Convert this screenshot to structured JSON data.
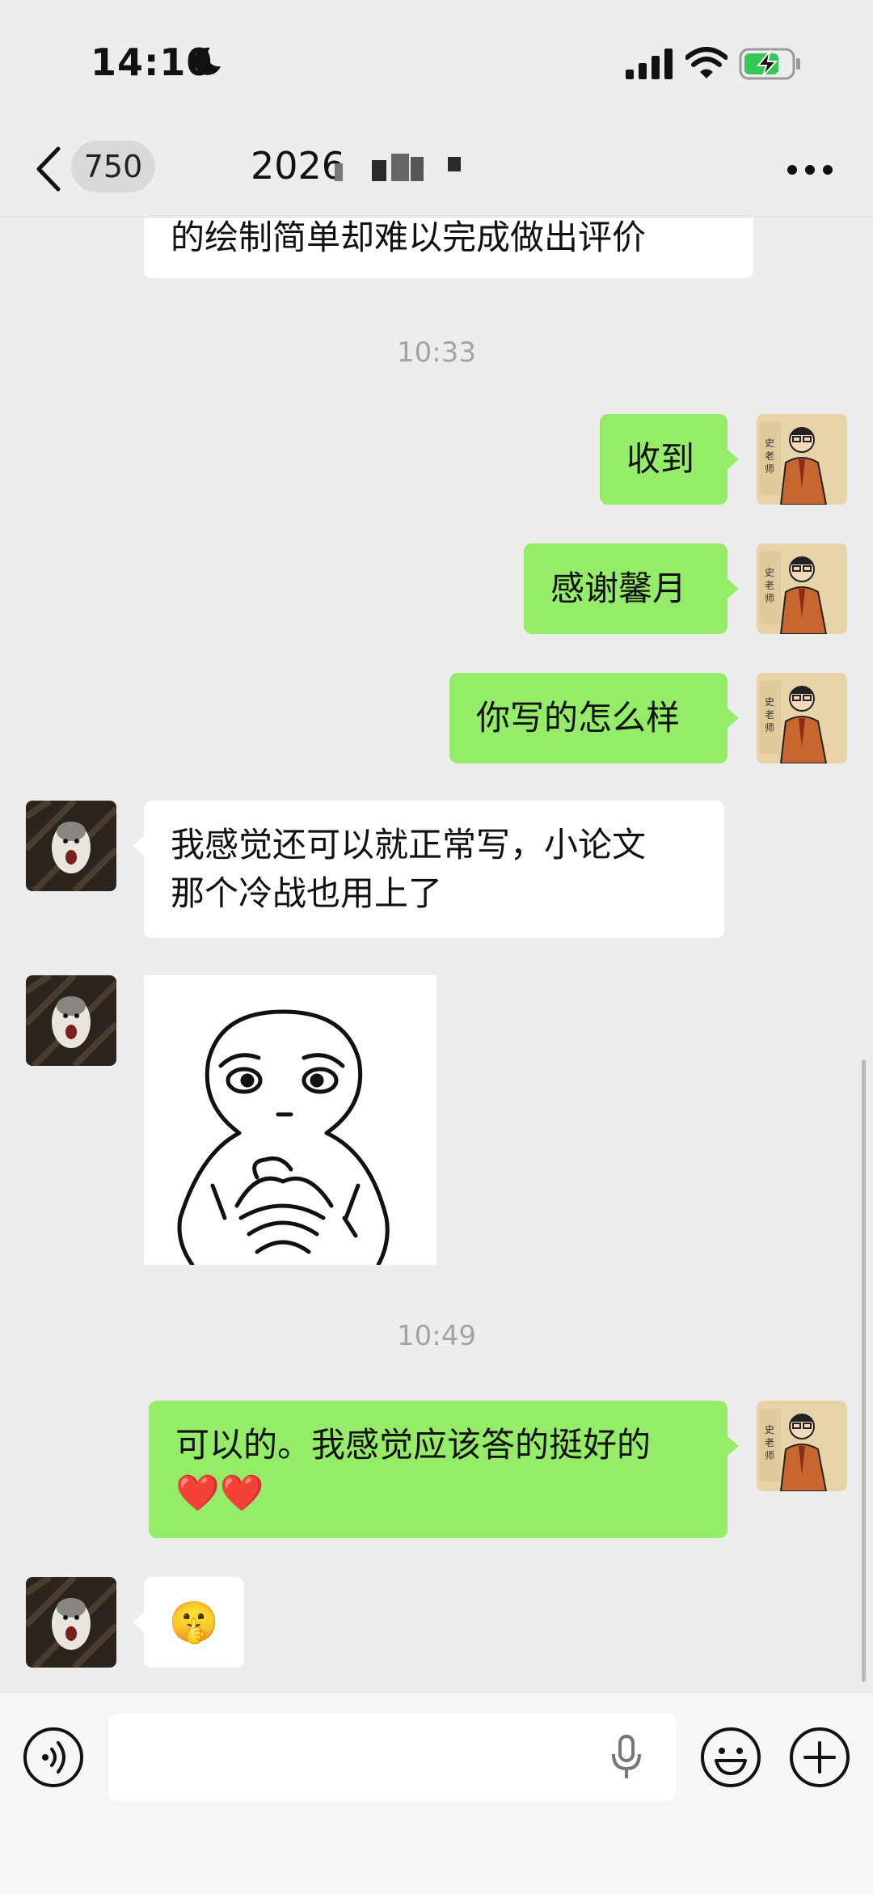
{
  "status_bar": {
    "time": "14:10"
  },
  "header": {
    "back_badge": "750",
    "title": "2026"
  },
  "messages": [
    {
      "side": "in",
      "text": "的绘制简单却难以完成做出评价"
    },
    {
      "timestamp": "10:33"
    },
    {
      "side": "out",
      "text": "收到"
    },
    {
      "side": "out",
      "text": "感谢馨月"
    },
    {
      "side": "out",
      "text": "你写的怎么样"
    },
    {
      "side": "in",
      "text_lines": [
        "我感觉还可以就正常写，小论文",
        "那个冷战也用上了"
      ]
    },
    {
      "side": "in",
      "type": "sticker",
      "sticker": "thinking-character"
    },
    {
      "timestamp": "10:49"
    },
    {
      "side": "out",
      "text": "可以的。我感觉应该答的挺好的",
      "emoji": "❤️❤️"
    },
    {
      "side": "in",
      "type": "emoji",
      "emoji": "🤫"
    }
  ],
  "input_bar": {
    "placeholder": ""
  },
  "colors": {
    "sent_bubble": "#95ec69",
    "received_bubble": "#ffffff",
    "background": "#ededed"
  }
}
